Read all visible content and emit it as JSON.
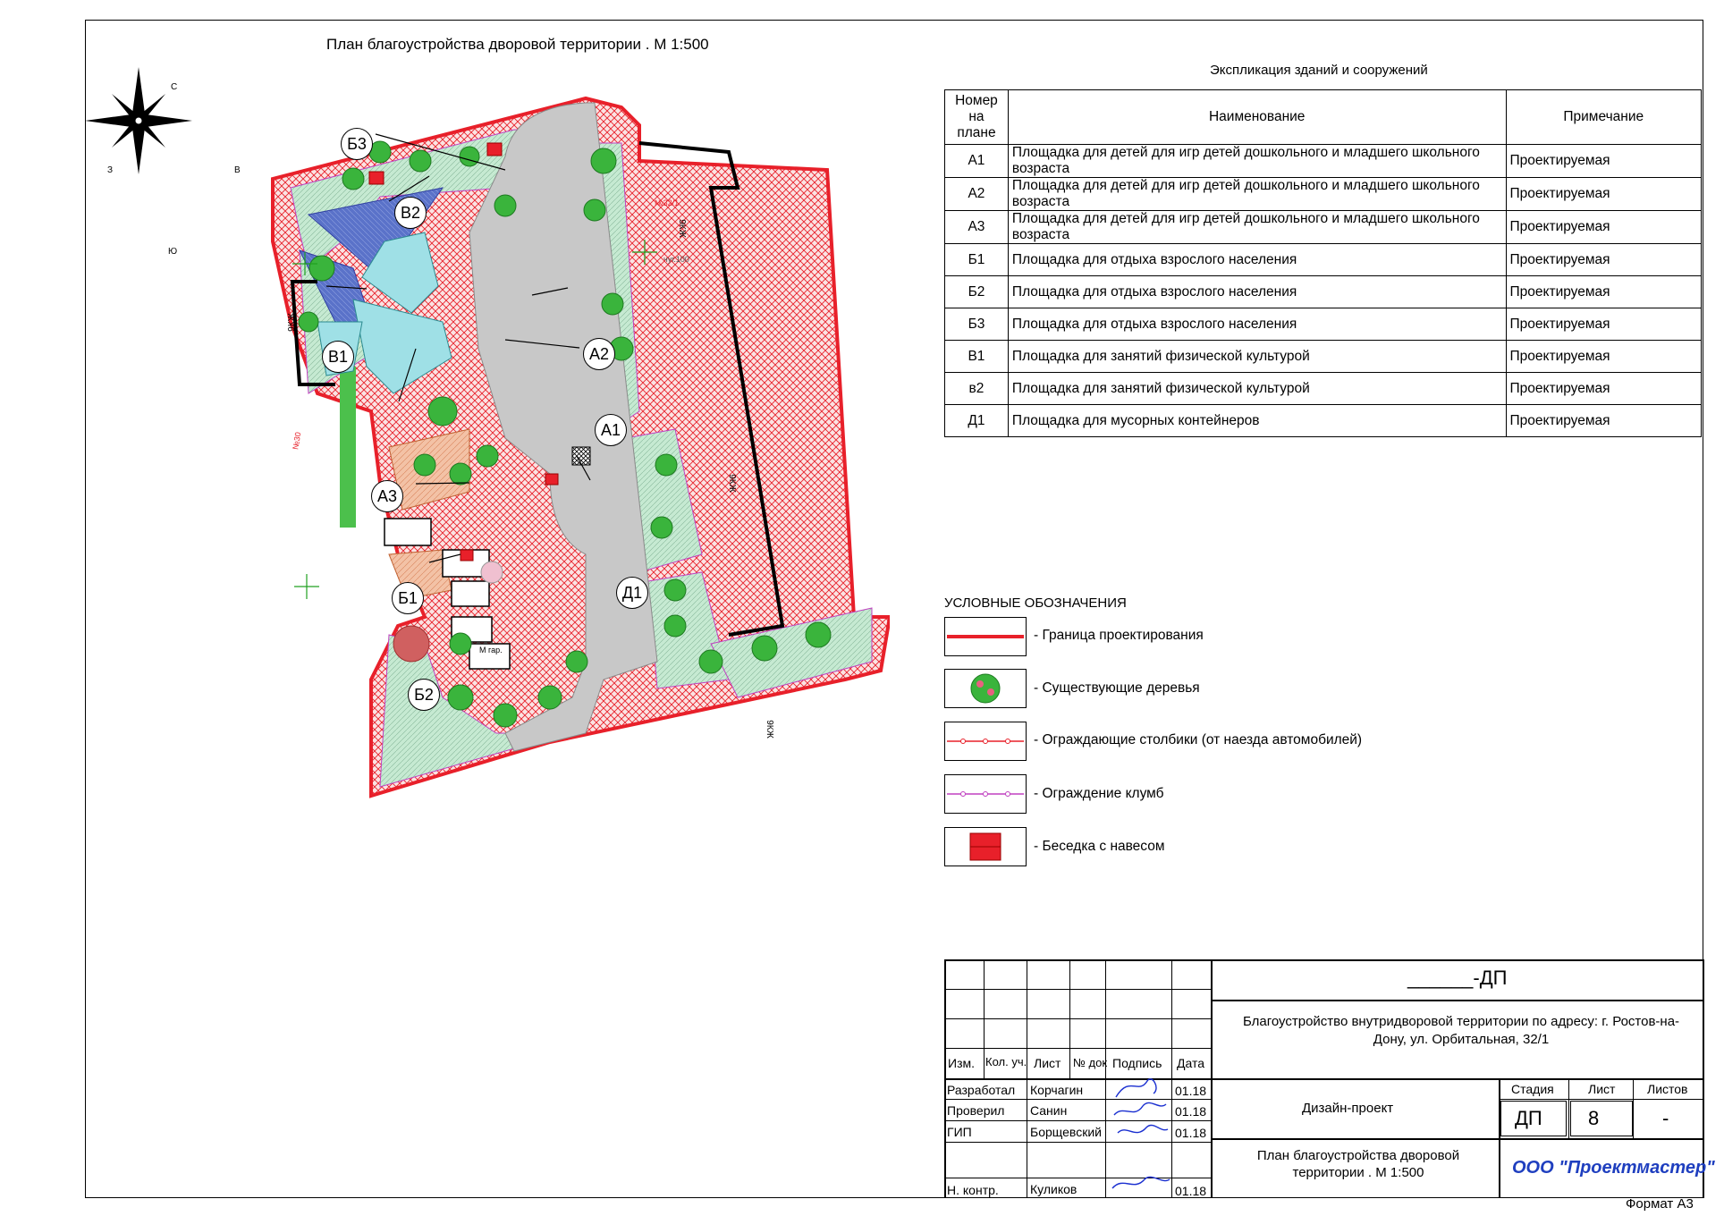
{
  "drawing": {
    "title": "План благоустройства дворовой территории . М 1:500",
    "format": "Формат А3",
    "compass": {
      "north": "С",
      "south": "Ю",
      "west": "З",
      "east": "В"
    },
    "plan_labels": [
      "Б3",
      "В2",
      "В1",
      "А2",
      "А1",
      "А3",
      "Б1",
      "Д1",
      "Б2"
    ],
    "map_annotations": {
      "building_left": "9КЖ",
      "building_right_top": "9КЖ",
      "building_right_mid": "9КЖ",
      "building_right_bot": "9КЖ",
      "house_num_left": "№30",
      "house_num_right": "№32/1",
      "garage": "М гар.",
      "entrance": "чуг.100"
    }
  },
  "explication": {
    "title": "Экспликация зданий и сооружений",
    "headers": {
      "num": "Номер на плане",
      "name": "Наименование",
      "note": "Примечание"
    },
    "rows": [
      {
        "num": "А1",
        "name": "Площадка для детей для игр детей дошкольного и младшего школьного возраста",
        "note": "Проектируемая"
      },
      {
        "num": "А2",
        "name": "Площадка для детей для игр детей дошкольного и младшего школьного возраста",
        "note": "Проектируемая"
      },
      {
        "num": "А3",
        "name": "Площадка для детей для игр детей дошкольного и младшего школьного возраста",
        "note": "Проектируемая"
      },
      {
        "num": "Б1",
        "name": "Площадка для отдыха взрослого населения",
        "note": "Проектируемая"
      },
      {
        "num": "Б2",
        "name": "Площадка для отдыха взрослого населения",
        "note": "Проектируемая"
      },
      {
        "num": "Б3",
        "name": "Площадка для отдыха взрослого населения",
        "note": "Проектируемая"
      },
      {
        "num": "В1",
        "name": "Площадка для занятий физической культурой",
        "note": "Проектируемая"
      },
      {
        "num": "в2",
        "name": "Площадка для занятий физической культурой",
        "note": "Проектируемая"
      },
      {
        "num": "Д1",
        "name": "Площадка для мусорных контейнеров",
        "note": "Проектируемая"
      }
    ]
  },
  "legend": {
    "title": "УСЛОВНЫЕ ОБОЗНАЧЕНИЯ",
    "items": [
      {
        "symbol": "boundary-line",
        "label": "- Граница проектирования"
      },
      {
        "symbol": "tree",
        "label": "- Существующие деревья"
      },
      {
        "symbol": "bollards",
        "label": "- Ограждающие столбики (от наезда автомобилей)"
      },
      {
        "symbol": "flowerbed-fence",
        "label": "- Ограждение клумб"
      },
      {
        "symbol": "gazebo",
        "label": "- Беседка с навесом"
      }
    ]
  },
  "title_block": {
    "doc_code": "______-ДП",
    "project": "Благоустройство внутридворовой территории по адресу: г. Ростов-на-Дону, ул. Орбитальная, 32/1",
    "stage_type": "Дизайн-проект",
    "sheet_title": "План благоустройства дворовой территории . М 1:500",
    "company": "ООО \"Проектмастер\"",
    "col_headers": {
      "izm": "Изм.",
      "kol": "Кол. уч.",
      "list": "Лист",
      "ndok": "№ док",
      "podpis": "Подпись",
      "data": "Дата"
    },
    "stage_headers": {
      "stage": "Стадия",
      "list": "Лист",
      "listov": "Листов"
    },
    "stage_values": {
      "stage": "ДП",
      "list": "8",
      "listov": "-"
    },
    "people": [
      {
        "role": "Разработал",
        "name": "Корчагин",
        "date": "01.18"
      },
      {
        "role": "Проверил",
        "name": "Санин",
        "date": "01.18"
      },
      {
        "role": "ГИП",
        "name": "Борщевский",
        "date": "01.18"
      },
      {
        "role": "Н. контр.",
        "name": "Куликов",
        "date": "01.18"
      }
    ]
  },
  "colors": {
    "boundary": "#e8202a",
    "hatch_red": "#e8202a",
    "lawn": "#b9e3c6",
    "road": "#c8c8c8",
    "playground": "#9fe0e6",
    "sport": "#5870c8",
    "rest": "#f0b89a",
    "tree": "#3ab43c",
    "company": "#1f3fbf",
    "signature": "#1a2fd0"
  }
}
